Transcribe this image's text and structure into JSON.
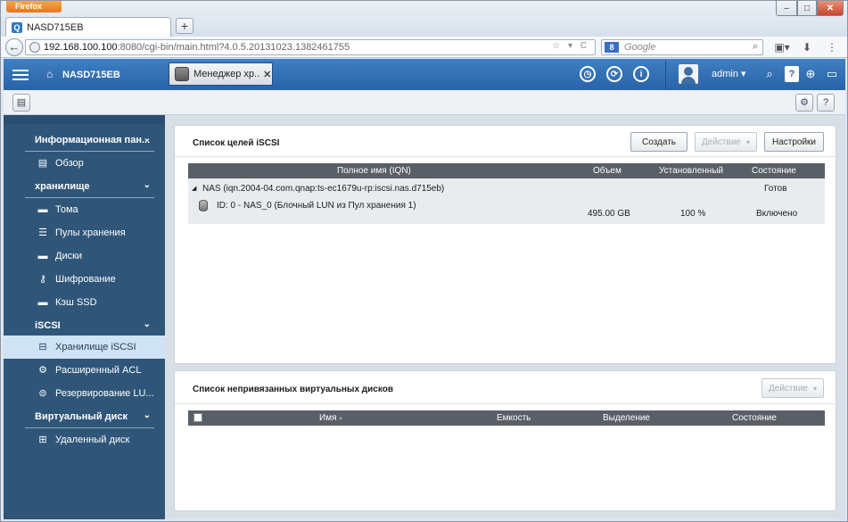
{
  "browser": {
    "menu_label": "Firefox",
    "tab_title": "NASD715EB",
    "tab_favicon": "Q",
    "new_tab": "+",
    "url_host": "192.168.100.100",
    "url_rest": ":8080/cgi-bin/main.html?4.0.5.20131023.1382461755",
    "search_placeholder": "Google",
    "search_engine_icon": "8",
    "window_min": "–",
    "window_max": "□",
    "window_close": "✕"
  },
  "appbar": {
    "home_label": "NASD715EB",
    "active_app_label": "Менеджер хр..",
    "close_tab": "✕",
    "user_label": "admin",
    "user_caret": "▾",
    "info": "i",
    "help": "?"
  },
  "subbar": {
    "help": "?"
  },
  "sidebar": {
    "groups": [
      {
        "label": "Информационная пан...",
        "chevron": "⌄"
      },
      {
        "label": "хранилище",
        "chevron": "⌄"
      },
      {
        "label": "iSCSI",
        "chevron": "⌄"
      },
      {
        "label": "Виртуальный диск",
        "chevron": "⌄"
      }
    ],
    "items": [
      {
        "label": "Обзор",
        "icon": "overview-icon"
      },
      {
        "label": "Тома",
        "icon": "volume-icon"
      },
      {
        "label": "Пулы хранения",
        "icon": "pool-icon"
      },
      {
        "label": "Диски",
        "icon": "disk-icon"
      },
      {
        "label": "Шифрование",
        "icon": "key-icon"
      },
      {
        "label": "Кэш SSD",
        "icon": "ssd-icon"
      },
      {
        "label": "Хранилище iSCSI",
        "icon": "iscsi-drive-icon"
      },
      {
        "label": "Расширенный ACL",
        "icon": "gear-icon"
      },
      {
        "label": "Резервирование LU...",
        "icon": "backup-icon"
      },
      {
        "label": "Удаленный диск",
        "icon": "remote-disk-icon"
      }
    ]
  },
  "panel1": {
    "title": "Список целей iSCSI",
    "create_label": "Создать",
    "action_label": "Действие",
    "settings_label": "Настройки",
    "columns": [
      "Полное имя (IQN)",
      "Объем",
      "Установленный",
      "Состояние"
    ],
    "target": {
      "expander": "◢",
      "name": "NAS (iqn.2004-04.com.qnap:ts-ec1679u-rp:iscsi.nas.d715eb)",
      "status": "Готов"
    },
    "lun": {
      "name": "ID: 0 - NAS_0 (Блочный LUN из Пул хранения 1)",
      "capacity": "495.00 GB",
      "allocated": "100 %",
      "status": "Включено"
    }
  },
  "panel2": {
    "title": "Список непривязанных виртуальных дисков",
    "action_label": "Действие",
    "columns": [
      "Имя",
      "Емкость",
      "Выделение",
      "Состояние"
    ],
    "sort_indicator": "▲"
  },
  "colors": {
    "appbar": "#2f6cb0",
    "sidebar": "#2f5679",
    "sidebar_active": "#cfe3f5",
    "table_header": "#595f66"
  }
}
